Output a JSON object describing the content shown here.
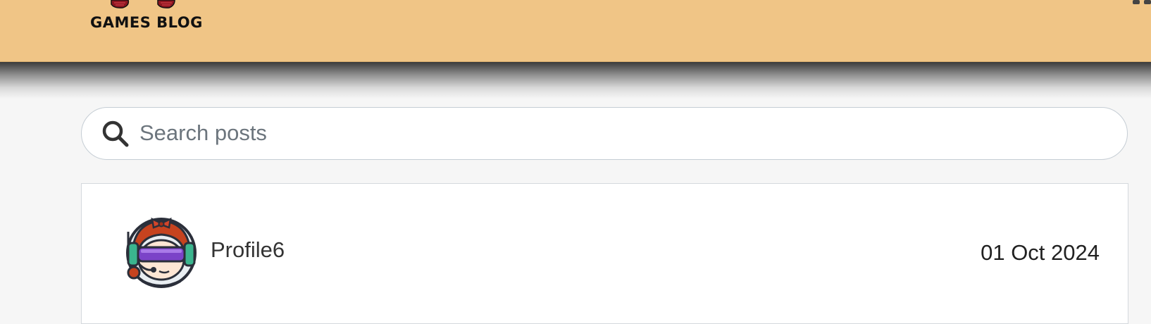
{
  "header": {
    "logo_text": "GAMES BLOG",
    "background_color": "#f0c586"
  },
  "search": {
    "placeholder": "Search posts",
    "value": "",
    "icon": "search-icon"
  },
  "posts": [
    {
      "author": "Profile6",
      "avatar_icon": "gamer-girl-avatar-icon",
      "date": "01 Oct 2024"
    }
  ]
}
